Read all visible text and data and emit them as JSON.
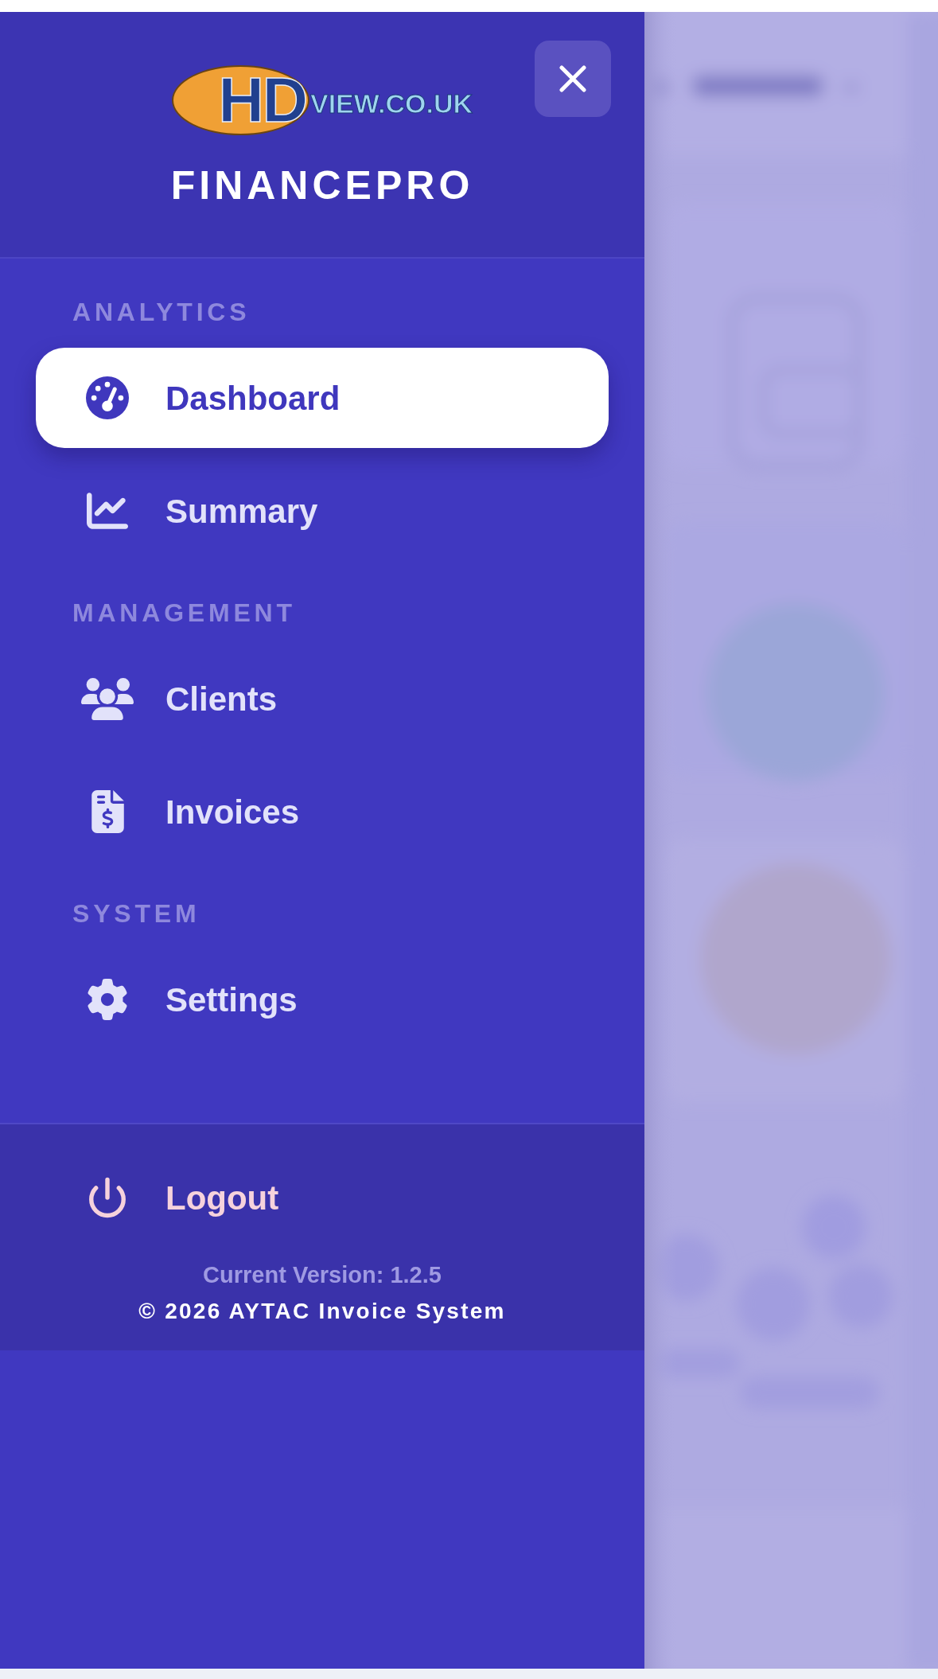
{
  "sidebar": {
    "logo": {
      "mark": "HD",
      "text": "VIEW.CO.UK"
    },
    "brand": "FINANCEPRO",
    "sections": [
      {
        "title": "ANALYTICS",
        "items": [
          {
            "label": "Dashboard",
            "selected": true
          },
          {
            "label": "Summary",
            "selected": false
          }
        ]
      },
      {
        "title": "MANAGEMENT",
        "items": [
          {
            "label": "Clients",
            "selected": false
          },
          {
            "label": "Invoices",
            "selected": false
          }
        ]
      },
      {
        "title": "SYSTEM",
        "items": [
          {
            "label": "Settings",
            "selected": false
          }
        ]
      }
    ],
    "footer": {
      "logout": "Logout",
      "version": "Current Version: 1.2.5",
      "copyright": "© 2026 AYTAC Invoice System"
    }
  }
}
